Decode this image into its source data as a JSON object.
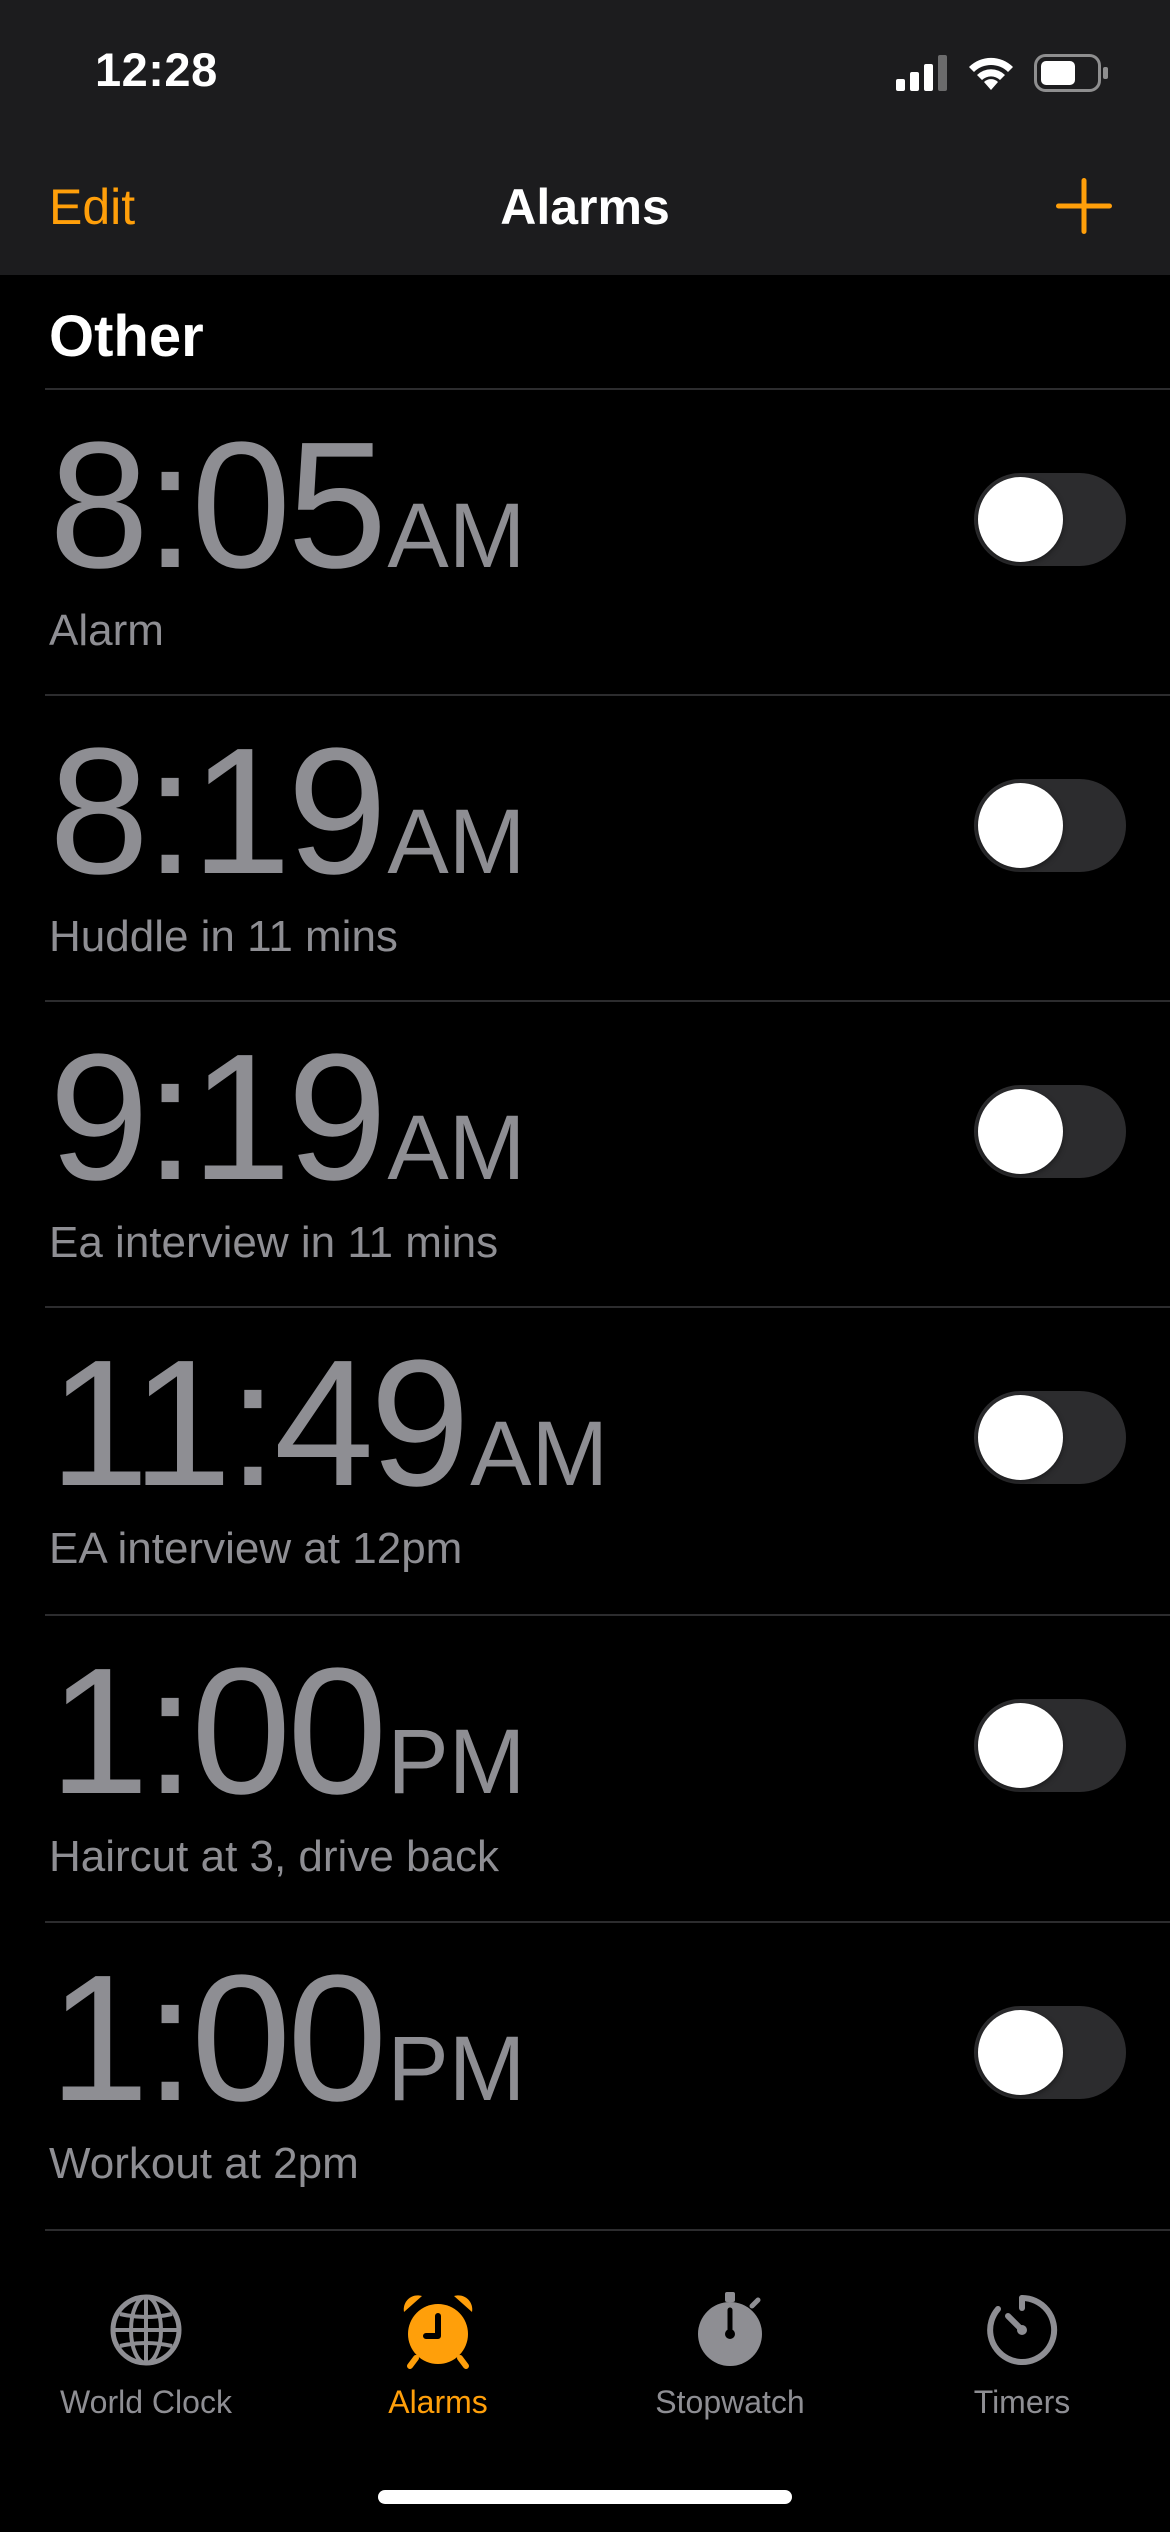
{
  "status": {
    "time": "12:28"
  },
  "nav": {
    "edit_label": "Edit",
    "title": "Alarms",
    "add_icon": "plus-icon"
  },
  "section": {
    "title": "Other"
  },
  "alarms": [
    {
      "time": "8:05",
      "period": "AM",
      "label": "Alarm",
      "enabled": false
    },
    {
      "time": "8:19",
      "period": "AM",
      "label": "Huddle in 11 mins",
      "enabled": false
    },
    {
      "time": "9:19",
      "period": "AM",
      "label": "Ea interview in 11 mins",
      "enabled": false
    },
    {
      "time": "11:49",
      "period": "AM",
      "label": "EA interview at 12pm",
      "enabled": false
    },
    {
      "time": "1:00",
      "period": "PM",
      "label": "Haircut at 3, drive back",
      "enabled": false
    },
    {
      "time": "1:00",
      "period": "PM",
      "label": "Workout at 2pm",
      "enabled": false
    }
  ],
  "tabs": [
    {
      "label": "World Clock",
      "icon": "globe-icon",
      "active": false
    },
    {
      "label": "Alarms",
      "icon": "alarm-clock-icon",
      "active": true
    },
    {
      "label": "Stopwatch",
      "icon": "stopwatch-icon",
      "active": false
    },
    {
      "label": "Timers",
      "icon": "timer-icon",
      "active": false
    }
  ],
  "colors": {
    "accent": "#ff9f0a",
    "inactive": "#8e8e93",
    "toggle_off": "#2c2c2e"
  }
}
